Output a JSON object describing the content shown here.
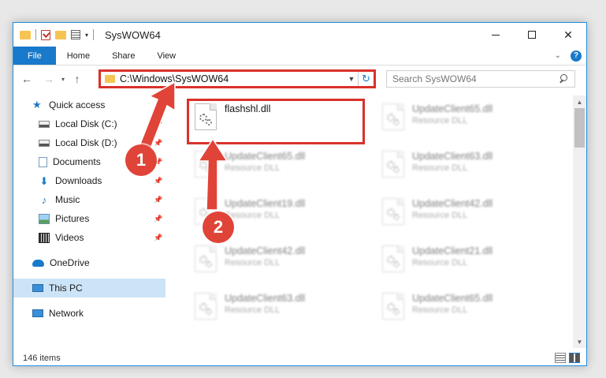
{
  "window": {
    "title": "SysWOW64"
  },
  "ribbon": {
    "tabs": [
      "File",
      "Home",
      "Share",
      "View"
    ],
    "help": "?"
  },
  "nav": {
    "address": "C:\\Windows\\SysWOW64",
    "search_placeholder": "Search SysWOW64"
  },
  "sidebar": {
    "items": [
      {
        "label": "Quick access",
        "icon": "star-icon"
      },
      {
        "label": "Local Disk (C:)",
        "icon": "drive-icon",
        "pinned": true
      },
      {
        "label": "Local Disk (D:)",
        "icon": "drive-icon",
        "pinned": true
      },
      {
        "label": "Documents",
        "icon": "documents-icon",
        "pinned": true
      },
      {
        "label": "Downloads",
        "icon": "downloads-icon",
        "pinned": true
      },
      {
        "label": "Music",
        "icon": "music-icon",
        "pinned": true
      },
      {
        "label": "Pictures",
        "icon": "pictures-icon",
        "pinned": true
      },
      {
        "label": "Videos",
        "icon": "videos-icon",
        "pinned": true
      },
      {
        "label": "OneDrive",
        "icon": "onedrive-icon"
      },
      {
        "label": "This PC",
        "icon": "pc-icon",
        "selected": true
      },
      {
        "label": "Network",
        "icon": "network-icon"
      }
    ]
  },
  "files": [
    {
      "name": "flashshl.dll",
      "type": ""
    },
    {
      "name": "UpdateClient65.dll",
      "type": "Resource DLL"
    },
    {
      "name": "UpdateClient65.dll",
      "type": "Resource DLL"
    },
    {
      "name": "UpdateClient63.dll",
      "type": "Resource DLL"
    },
    {
      "name": "UpdateClient19.dll",
      "type": "Resource DLL"
    },
    {
      "name": "UpdateClient42.dll",
      "type": "Resource DLL"
    },
    {
      "name": "UpdateClient42.dll",
      "type": "Resource DLL"
    },
    {
      "name": "UpdateClient21.dll",
      "type": "Resource DLL"
    },
    {
      "name": "UpdateClient63.dll",
      "type": "Resource DLL"
    },
    {
      "name": "UpdateClient65.dll",
      "type": "Resource DLL"
    }
  ],
  "status": {
    "count": "146 items"
  },
  "annotations": {
    "badge1": "1",
    "badge2": "2",
    "color": "#e04438"
  }
}
